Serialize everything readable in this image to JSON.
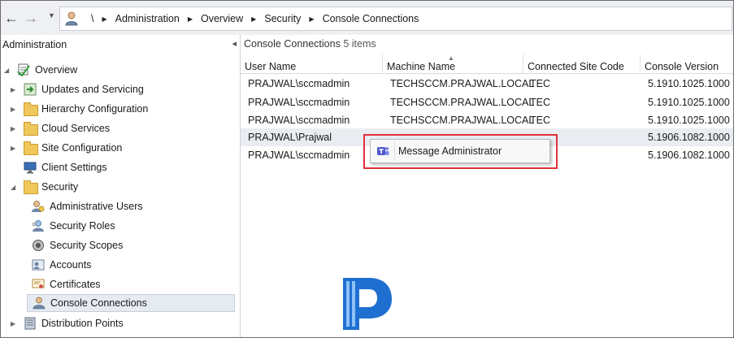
{
  "address_bar": {
    "crumbs": [
      "\\",
      "Administration",
      "Overview",
      "Security",
      "Console Connections"
    ]
  },
  "left_panel": {
    "title": "Administration",
    "tree": [
      {
        "label": "Overview"
      },
      {
        "label": "Updates and Servicing"
      },
      {
        "label": "Hierarchy Configuration"
      },
      {
        "label": "Cloud Services"
      },
      {
        "label": "Site Configuration"
      },
      {
        "label": "Client Settings"
      },
      {
        "label": "Security"
      },
      {
        "label": "Administrative Users"
      },
      {
        "label": "Security Roles"
      },
      {
        "label": "Security Scopes"
      },
      {
        "label": "Accounts"
      },
      {
        "label": "Certificates"
      },
      {
        "label": "Console Connections"
      },
      {
        "label": "Distribution Points"
      }
    ]
  },
  "main": {
    "title": "Console Connections",
    "count": "5 items",
    "columns": [
      "User Name",
      "Machine Name",
      "Connected Site Code",
      "Console Version"
    ],
    "rows": [
      {
        "user": "PRAJWAL\\sccmadmin",
        "machine": "TECHSCCM.PRAJWAL.LOCAL",
        "site": "TEC",
        "version": "5.1910.1025.1000"
      },
      {
        "user": "PRAJWAL\\sccmadmin",
        "machine": "TECHSCCM.PRAJWAL.LOCAL",
        "site": "TEC",
        "version": "5.1910.1025.1000"
      },
      {
        "user": "PRAJWAL\\sccmadmin",
        "machine": "TECHSCCM.PRAJWAL.LOCAL",
        "site": "TEC",
        "version": "5.1910.1025.1000"
      },
      {
        "user": "PRAJWAL\\Prajwal",
        "machine": "",
        "site": "",
        "version": "5.1906.1082.1000"
      },
      {
        "user": "PRAJWAL\\sccmadmin",
        "machine": "",
        "site": "",
        "version": "5.1906.1082.1000"
      }
    ]
  },
  "context_menu": {
    "item": "Message Administrator",
    "icon": "teams-icon"
  },
  "colors": {
    "highlight_border": "#e2303a",
    "selection": "#e9ecf1",
    "logo_blue": "#1f6fd1"
  }
}
